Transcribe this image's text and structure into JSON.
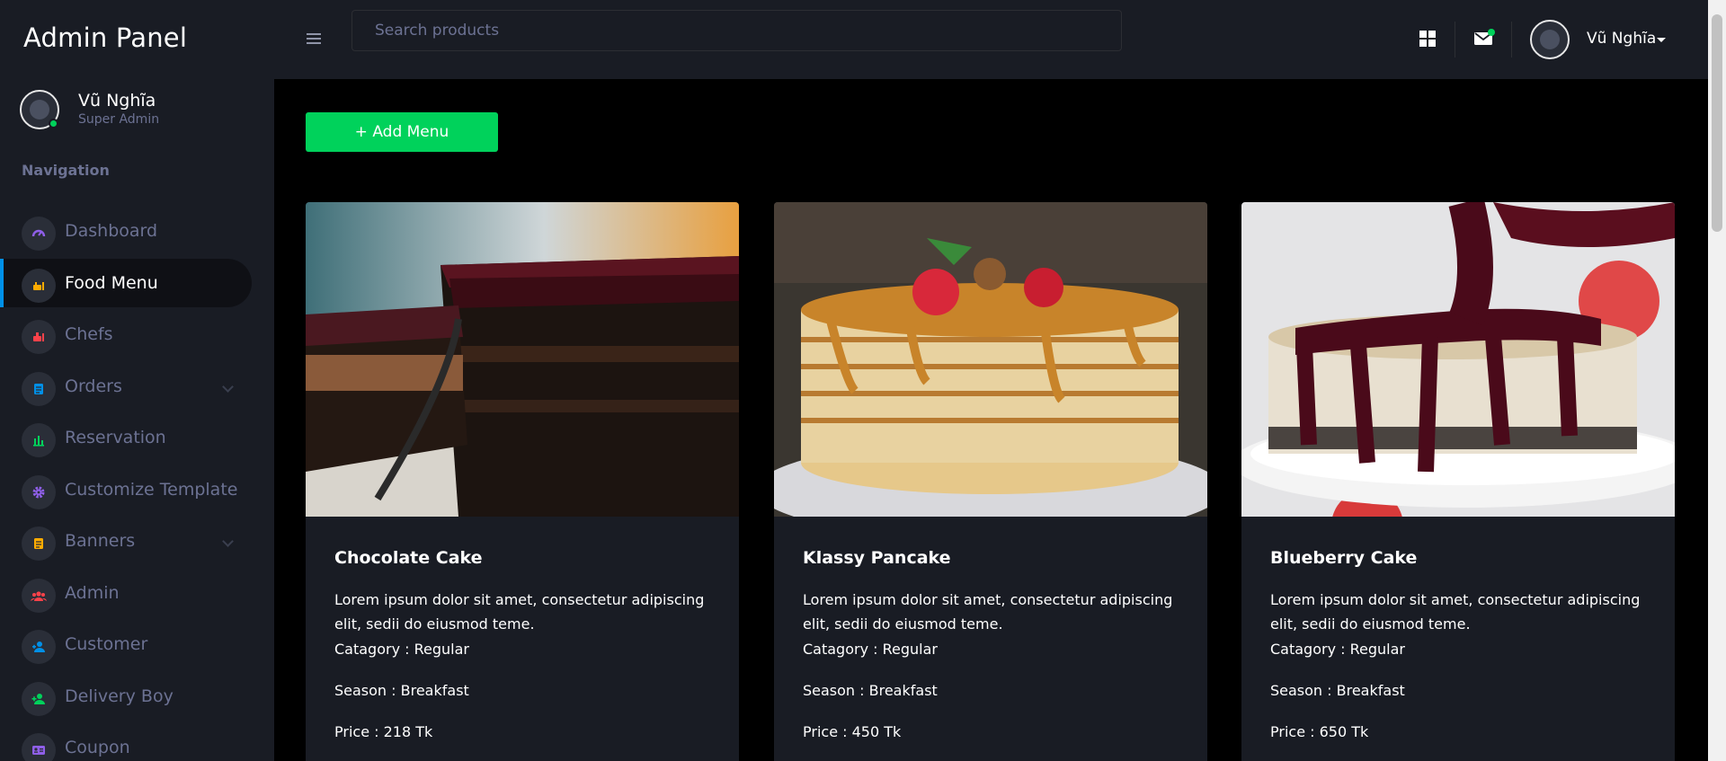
{
  "sidebar": {
    "brand": "Admin Panel",
    "profile": {
      "name": "Vũ Nghĩa",
      "role": "Super Admin"
    },
    "nav_title": "Navigation",
    "items": [
      {
        "label": "Dashboard",
        "icon": "speedometer-icon",
        "color": "#8f5fe8"
      },
      {
        "label": "Food Menu",
        "icon": "food-icon",
        "color": "#ffab00",
        "active": true
      },
      {
        "label": "Chefs",
        "icon": "chef-icon",
        "color": "#fc424a"
      },
      {
        "label": "Orders",
        "icon": "clipboard-icon",
        "color": "#0090e7",
        "has_chevron": true
      },
      {
        "label": "Reservation",
        "icon": "chart-bar-icon",
        "color": "#00d25b"
      },
      {
        "label": "Customize Template",
        "icon": "gear-icon",
        "color": "#8f5fe8"
      },
      {
        "label": "Banners",
        "icon": "document-icon",
        "color": "#ffab00",
        "has_chevron": true
      },
      {
        "label": "Admin",
        "icon": "users-icon",
        "color": "#fc424a"
      },
      {
        "label": "Customer",
        "icon": "user-icon",
        "color": "#0090e7"
      },
      {
        "label": "Delivery Boy",
        "icon": "user-plus-icon",
        "color": "#00d25b"
      },
      {
        "label": "Coupon",
        "icon": "card-icon",
        "color": "#8f5fe8"
      }
    ]
  },
  "topbar": {
    "search_placeholder": "Search products",
    "user_name": "Vũ Nghĩa"
  },
  "main": {
    "add_button": "+ Add Menu",
    "cards": [
      {
        "title": "Chocolate Cake",
        "description": "Lorem ipsum dolor sit amet, consectetur adipiscing elit, sedii do eiusmod teme.",
        "category": "Catagory : Regular",
        "season": "Season : Breakfast",
        "price": "Price : 218 Tk"
      },
      {
        "title": "Klassy Pancake",
        "description": "Lorem ipsum dolor sit amet, consectetur adipiscing elit, sedii do eiusmod teme.",
        "category": "Catagory : Regular",
        "season": "Season : Breakfast",
        "price": "Price : 450 Tk"
      },
      {
        "title": "Blueberry Cake",
        "description": "Lorem ipsum dolor sit amet, consectetur adipiscing elit, sedii do eiusmod teme.",
        "category": "Catagory : Regular",
        "season": "Season : Breakfast",
        "price": "Price : 650 Tk"
      }
    ]
  },
  "colors": {
    "accent_green": "#00d25b",
    "active_bar": "#0090e7",
    "sidebar_bg": "#191c24",
    "text_muted": "#6c7293"
  }
}
